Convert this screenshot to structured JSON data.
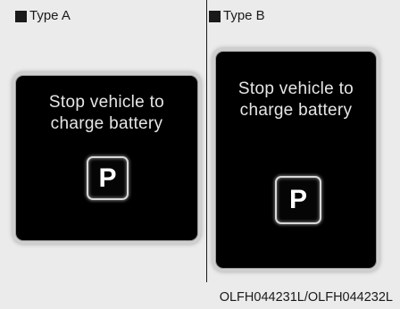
{
  "type_a": {
    "label": "Type A",
    "message_line1": "Stop vehicle to",
    "message_line2": "charge battery",
    "gear": "P"
  },
  "type_b": {
    "label": "Type B",
    "message_line1": "Stop vehicle to",
    "message_line2": "charge battery",
    "gear": "P"
  },
  "figure_code": "OLFH044231L/OLFH044232L",
  "colors": {
    "background": "#ebebeb",
    "display": "#000000",
    "text": "#e6e6e6",
    "bezel": "#cfcfcf"
  }
}
